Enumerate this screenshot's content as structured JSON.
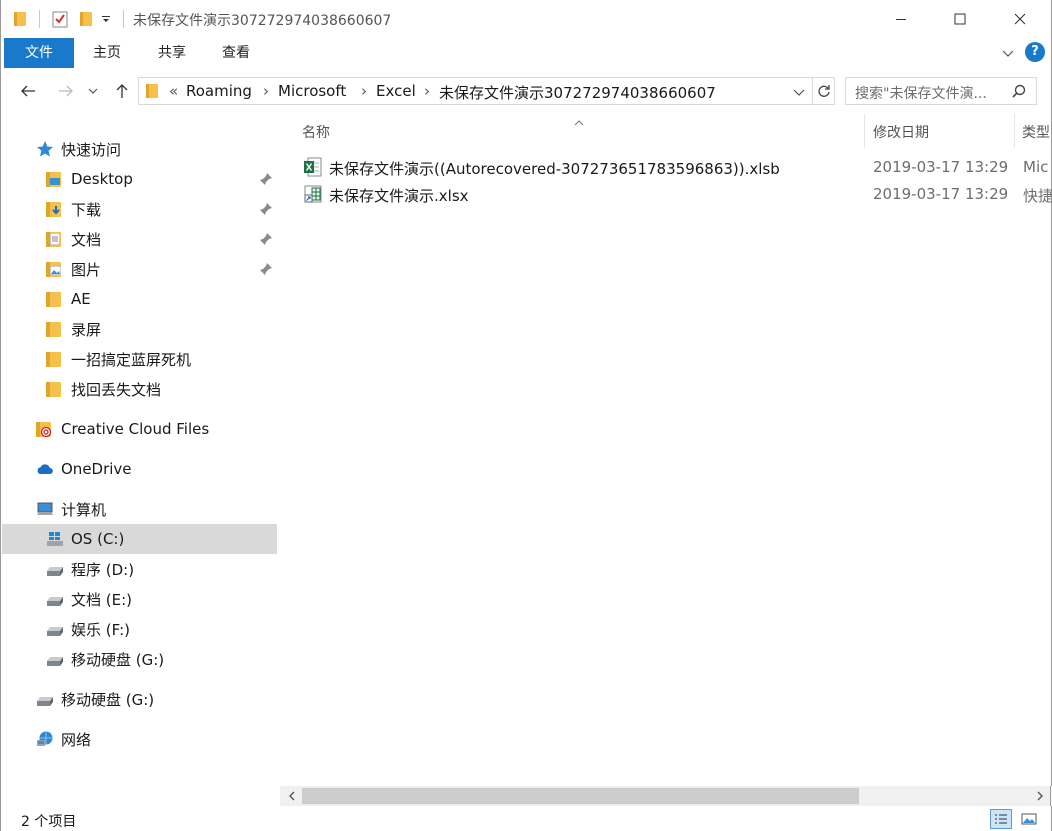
{
  "window": {
    "title": "未保存文件演示307272974038660607",
    "controls": {
      "minimize": "minimize",
      "maximize": "maximize",
      "close": "close"
    }
  },
  "ribbon": {
    "tabs": [
      {
        "label": "文件"
      },
      {
        "label": "主页"
      },
      {
        "label": "共享"
      },
      {
        "label": "查看"
      }
    ],
    "help": "?"
  },
  "address": {
    "overflow": "«",
    "crumbs": [
      "Roaming",
      "Microsoft",
      "Excel",
      "未保存文件演示307272974038660607"
    ],
    "search_placeholder": "搜索\"未保存文件演..."
  },
  "nav": {
    "quick_access": "快速访问",
    "quick_items": [
      {
        "label": "Desktop",
        "pinned": true,
        "icon": "desktop-folder-icon"
      },
      {
        "label": "下载",
        "pinned": true,
        "icon": "download-folder-icon"
      },
      {
        "label": "文档",
        "pinned": true,
        "icon": "documents-folder-icon"
      },
      {
        "label": "图片",
        "pinned": true,
        "icon": "pictures-folder-icon"
      },
      {
        "label": "AE",
        "pinned": false,
        "icon": "folder-icon"
      },
      {
        "label": "录屏",
        "pinned": false,
        "icon": "folder-icon"
      },
      {
        "label": "一招搞定蓝屏死机",
        "pinned": false,
        "icon": "folder-icon"
      },
      {
        "label": "找回丢失文档",
        "pinned": false,
        "icon": "folder-icon"
      }
    ],
    "creative_cloud": "Creative Cloud Files",
    "onedrive": "OneDrive",
    "computer": "计算机",
    "drives": [
      {
        "label": "OS (C:)",
        "selected": true
      },
      {
        "label": "程序 (D:)",
        "selected": false
      },
      {
        "label": "文档 (E:)",
        "selected": false
      },
      {
        "label": "娱乐 (F:)",
        "selected": false
      },
      {
        "label": "移动硬盘 (G:)",
        "selected": false
      }
    ],
    "removable": "移动硬盘 (G:)",
    "network": "网络"
  },
  "columns": {
    "name": "名称",
    "modified": "修改日期",
    "type": "类型"
  },
  "files": [
    {
      "name": "未保存文件演示((Autorecovered-307273651783596863)).xlsb",
      "modified": "2019-03-17 13:29",
      "type": "Mic",
      "icon": "excel-xlsb-icon"
    },
    {
      "name": "未保存文件演示.xlsx",
      "modified": "2019-03-17 13:29",
      "type": "快捷",
      "icon": "excel-shortcut-icon"
    }
  ],
  "status": {
    "item_count": "2 个项目"
  },
  "colors": {
    "accent": "#1979ca",
    "selected_bg": "#d9d9d9",
    "folder": "#f6c14a"
  }
}
